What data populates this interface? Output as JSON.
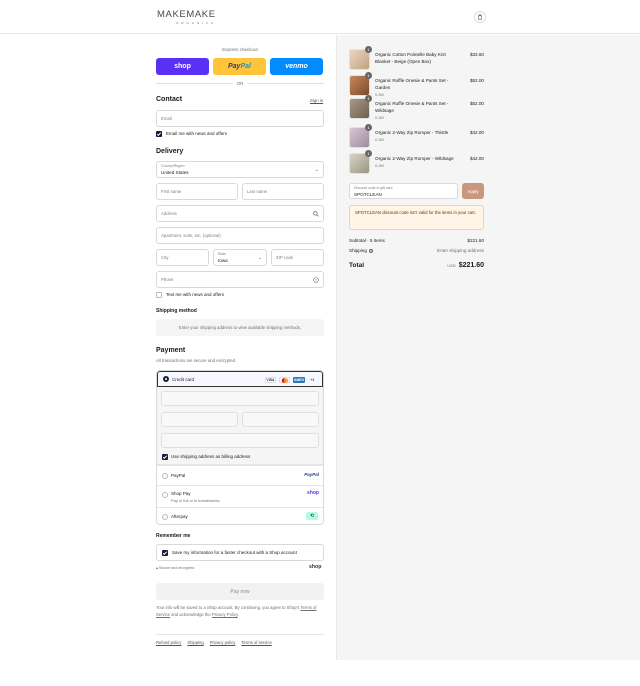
{
  "brand": {
    "logo_main": "MAKEMAKE",
    "logo_sub": "ORGANICS"
  },
  "express": {
    "label": "Express checkout",
    "shop_label": "shop",
    "paypal_label_a": "Pay",
    "paypal_label_b": "Pal",
    "venmo_label": "venmo",
    "or_label": "OR"
  },
  "contact": {
    "heading": "Contact",
    "sign_in": "Sign in",
    "email_placeholder": "Email",
    "news_label": "Email me with news and offers"
  },
  "delivery": {
    "heading": "Delivery",
    "country_label": "Country/Region",
    "country_value": "United States",
    "first_name": "First name",
    "last_name": "Last name",
    "address": "Address",
    "apartment": "Apartment, suite, etc. (optional)",
    "city": "City",
    "state_label": "State",
    "state_value": "Iowa",
    "zip": "ZIP code",
    "phone": "Phone",
    "text_label": "Text me with news and offers"
  },
  "shipping_method": {
    "heading": "Shipping method",
    "note": "Enter your shipping address to view available shipping methods."
  },
  "payment": {
    "heading": "Payment",
    "subtitle": "All transactions are secure and encrypted.",
    "credit_card": "Credit card",
    "brands": [
      "VISA",
      "MC",
      "AMEX",
      "+1"
    ],
    "billing_same": "Use shipping address as billing address",
    "paypal": "PayPal",
    "paypal_logo": "PayPal",
    "shop_pay": "Shop Pay",
    "shop_pay_sub": "Pay in full or in installments",
    "shop_pay_logo": "shop",
    "afterpay": "Afterpay"
  },
  "remember": {
    "heading": "Remember me",
    "save_label": "Save my information for a faster checkout with a Shop account",
    "secure": "Secure and encrypted",
    "shop_logo": "shop"
  },
  "pay_now": "Pay now",
  "legal": {
    "text_1": "Your info will be saved to a Shop account. By continuing, you agree to Shop's",
    "terms": "Terms of Service",
    "text_2": "and acknowledge the",
    "privacy": "Privacy Policy",
    "period": "."
  },
  "footer": [
    "Refund policy",
    "Shipping",
    "Privacy policy",
    "Terms of service"
  ],
  "colors": {
    "shop": "#5a31f4",
    "paypal": "#ffc439",
    "venmo": "#008cff",
    "apply": "#c9967e"
  },
  "order": {
    "items": [
      {
        "qty": "1",
        "name": "Organic Cotton Pointelle Baby Knit Blanket - Beige (Open Box)",
        "variant": "",
        "price": "$33.60"
      },
      {
        "qty": "1",
        "name": "Organic Ruffle Onesie & Pants Set - Garden",
        "variant": "0-3M",
        "price": "$52.00"
      },
      {
        "qty": "1",
        "name": "Organic Ruffle Onesie & Pants Set - Wildsage",
        "variant": "0-3M",
        "price": "$52.00"
      },
      {
        "qty": "1",
        "name": "Organic 2-Way Zip Romper - Thistle",
        "variant": "0-3M",
        "price": "$42.00"
      },
      {
        "qty": "1",
        "name": "Organic 2-Way Zip Romper - Wildsage",
        "variant": "0-3M",
        "price": "$42.00"
      }
    ],
    "discount_label": "Discount code or gift card",
    "discount_value": "SPOTCLEAN",
    "apply_label": "Apply",
    "warning": "SPOTCLEAN discount code isn't valid for the items in your cart.",
    "subtotal_label": "Subtotal · 5 items",
    "subtotal_value": "$221.60",
    "shipping_label": "Shipping",
    "shipping_value": "Enter shipping address",
    "total_label": "Total",
    "currency": "USD",
    "total_value": "$221.60"
  }
}
